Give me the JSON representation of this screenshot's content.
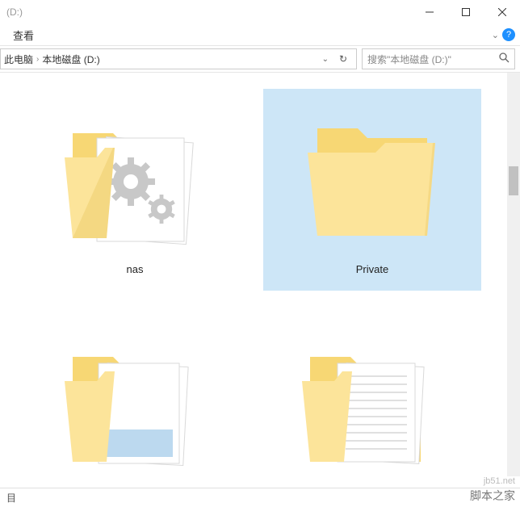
{
  "title": "(D:)",
  "menu": {
    "view": "查看"
  },
  "breadcrumb": {
    "pc": "此电脑",
    "drive": "本地磁盘 (D:)"
  },
  "search": {
    "placeholder": "搜索\"本地磁盘 (D:)\""
  },
  "items": [
    {
      "label": "nas"
    },
    {
      "label": "Private"
    },
    {
      "label": ""
    },
    {
      "label": ""
    }
  ],
  "status": "目",
  "watermark_top": "jb51.net",
  "watermark_bottom": "脚本之家"
}
